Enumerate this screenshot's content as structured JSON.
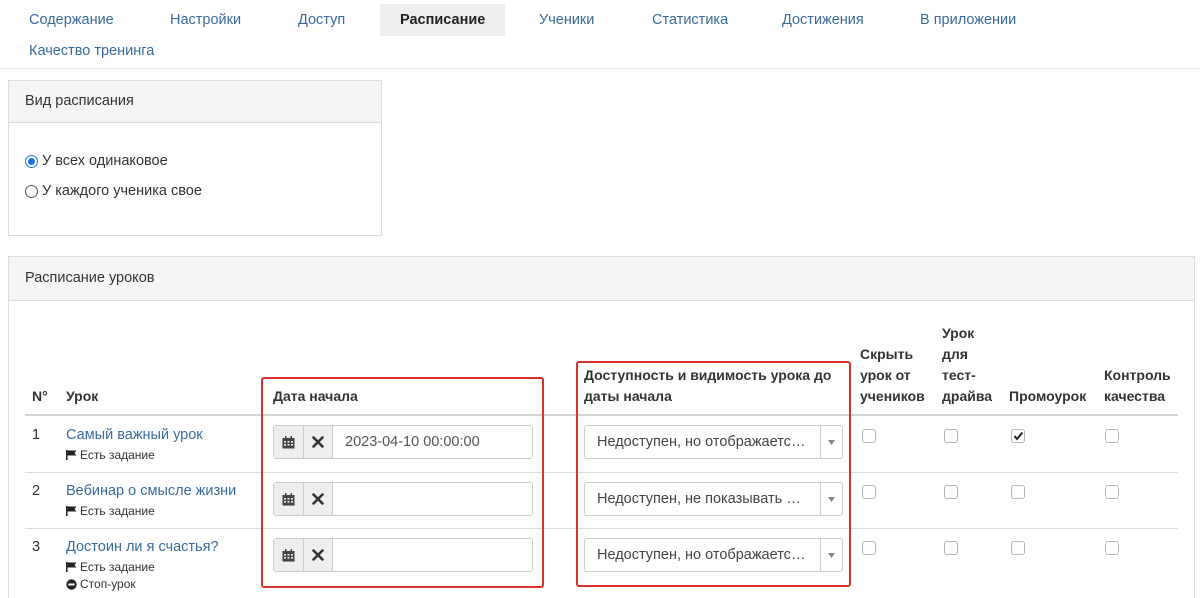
{
  "tabs": [
    {
      "label": "Содержание",
      "active": false
    },
    {
      "label": "Настройки",
      "active": false
    },
    {
      "label": "Доступ",
      "active": false
    },
    {
      "label": "Расписание",
      "active": true
    },
    {
      "label": "Ученики",
      "active": false
    },
    {
      "label": "Статистика",
      "active": false
    },
    {
      "label": "Достижения",
      "active": false
    },
    {
      "label": "В приложении",
      "active": false
    },
    {
      "label": "Качество тренинга",
      "active": false
    }
  ],
  "schedule_type": {
    "title": "Вид расписания",
    "options": [
      {
        "label": "У всех одинаковое",
        "selected": true
      },
      {
        "label": "У каждого ученика свое",
        "selected": false
      }
    ]
  },
  "lessons_schedule": {
    "title": "Расписание уроков",
    "columns": {
      "num": "N°",
      "lesson": "Урок",
      "start_date": "Дата начала",
      "availability": "Доступность и видимость урока до даты начала",
      "hide": "Скрыть урок от учеников",
      "test_drive": "Урок для тест-драйва",
      "promo": "Промоурок",
      "quality": "Контроль качества"
    },
    "rows": [
      {
        "num": "1",
        "title": "Самый важный урок",
        "tags": [
          "Есть задание"
        ],
        "date": "2023-04-10 00:00:00",
        "availability": "Недоступен, но отображается в расписании",
        "hide": false,
        "test_drive": false,
        "promo": true,
        "quality": false
      },
      {
        "num": "2",
        "title": "Вебинар о смысле жизни",
        "tags": [
          "Есть задание"
        ],
        "date": "",
        "availability": "Недоступен, не показывать в расписании",
        "hide": false,
        "test_drive": false,
        "promo": false,
        "quality": false
      },
      {
        "num": "3",
        "title": "Достоин ли я счастья?",
        "tags": [
          "Есть задание",
          "Стоп-урок"
        ],
        "date": "",
        "availability": "Недоступен, но отображается в расписании",
        "hide": false,
        "test_drive": false,
        "promo": false,
        "quality": false
      }
    ]
  },
  "icons": {
    "calendar": "calendar-icon",
    "clear": "close-icon",
    "flag": "flag-icon",
    "stop": "stop-icon",
    "arrow": "caret-down-icon",
    "check": "checkmark-icon"
  },
  "colors": {
    "link": "#3a6a9c",
    "highlight": "#d9312b",
    "radio": "#1a73e8"
  }
}
